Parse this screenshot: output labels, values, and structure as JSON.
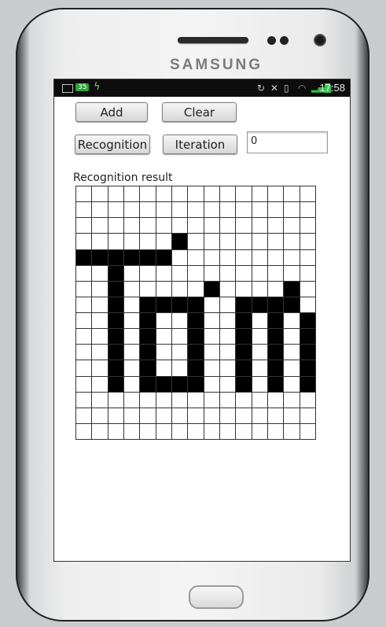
{
  "device": {
    "brand": "SAMSUNG"
  },
  "status_bar": {
    "notification_count": "35",
    "time": "17:58",
    "icons": [
      "mail-icon",
      "usb-icon",
      "sync-icon",
      "mute-icon",
      "vibrate-icon",
      "wifi-icon",
      "signal-icon",
      "battery-icon"
    ]
  },
  "toolbar": {
    "add_label": "Add",
    "clear_label": "Clear",
    "recognition_label": "Recognition",
    "iteration_label": "Iteration",
    "iteration_value": "0"
  },
  "result": {
    "label": "Recognition result",
    "columns": 15,
    "rows": 16,
    "pattern": [
      "...............",
      "...............",
      "...............",
      "......x........",
      "xxxxxx.........",
      "..x............",
      "..x.....x....x.",
      "..x.xxxx..xxxx.",
      "..x.x..x..x.x.x",
      "..x.x..x..x.x.x",
      "..x.x..x..x.x.x",
      "..x.x..x..x.x.x",
      "..x.xxxx..x.x.x",
      "...............",
      "...............",
      "..............."
    ]
  },
  "colors": {
    "cell_on": "#000000",
    "cell_off": "#ffffff",
    "status_bar": "#0d0d0d"
  }
}
